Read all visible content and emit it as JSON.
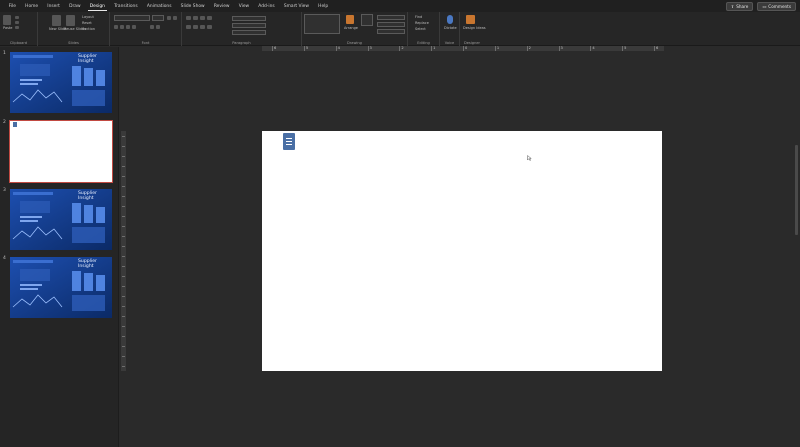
{
  "menu": {
    "tabs": [
      "File",
      "Home",
      "Insert",
      "Draw",
      "Design",
      "Transitions",
      "Animations",
      "Slide Show",
      "Review",
      "View",
      "Add-ins",
      "Smart View",
      "Help"
    ],
    "active_tab": "Design",
    "share_label": "Share",
    "comments_label": "Comments"
  },
  "ribbon": {
    "groups": {
      "clipboard": "Clipboard",
      "slides": "Slides",
      "font": "Font",
      "paragraph": "Paragraph",
      "drawing": "Drawing",
      "editing": "Editing",
      "voice": "Voice",
      "designer": "Designer"
    },
    "paste_label": "Paste",
    "new_slide_label": "New Slide",
    "reuse_slides_label": "Reuse Slides",
    "layout_label": "Layout",
    "reset_label": "Reset",
    "section_label": "Section",
    "arrange_label": "Arrange",
    "find_label": "Find",
    "replace_label": "Replace",
    "select_label": "Select",
    "dictate_label": "Dictate",
    "design_ideas_label": "Design Ideas"
  },
  "ruler": {
    "labels": [
      "6",
      "5",
      "4",
      "3",
      "2",
      "1",
      "0",
      "1",
      "2",
      "3",
      "4",
      "5",
      "6"
    ]
  },
  "thumbnails": [
    {
      "number": "1",
      "title": "Supplier Insight",
      "type": "dashboard"
    },
    {
      "number": "2",
      "title": "",
      "type": "blank"
    },
    {
      "number": "3",
      "title": "Supplier Insight",
      "type": "dashboard"
    },
    {
      "number": "4",
      "title": "Supplier Insight",
      "type": "dashboard"
    }
  ],
  "colors": {
    "accent": "#c24a42",
    "dashboard_bg": "#143c8a",
    "object_blue": "#4a6fa5"
  }
}
